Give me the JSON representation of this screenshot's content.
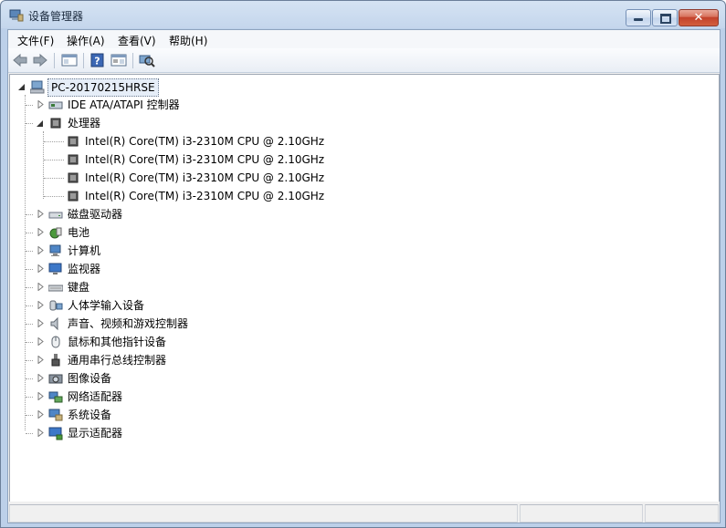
{
  "window": {
    "title": "设备管理器"
  },
  "menubar": {
    "items": [
      {
        "label": "文件(F)"
      },
      {
        "label": "操作(A)"
      },
      {
        "label": "查看(V)"
      },
      {
        "label": "帮助(H)"
      }
    ]
  },
  "toolbar": {
    "buttons": [
      {
        "name": "back-arrow-icon"
      },
      {
        "name": "forward-arrow-icon"
      },
      {
        "name": "show-hide-tree-icon"
      },
      {
        "name": "help-icon"
      },
      {
        "name": "properties-icon"
      },
      {
        "name": "scan-hardware-icon"
      }
    ]
  },
  "tree": {
    "root": {
      "label": "PC-20170215HRSE",
      "icon": "computer-icon",
      "expanded": true
    },
    "categories": [
      {
        "label": "IDE ATA/ATAPI 控制器",
        "icon": "ide-controller-icon",
        "expanded": false
      },
      {
        "label": "处理器",
        "icon": "processor-icon",
        "expanded": true,
        "children": [
          {
            "label": "Intel(R) Core(TM) i3-2310M CPU @ 2.10GHz"
          },
          {
            "label": "Intel(R) Core(TM) i3-2310M CPU @ 2.10GHz"
          },
          {
            "label": "Intel(R) Core(TM) i3-2310M CPU @ 2.10GHz"
          },
          {
            "label": "Intel(R) Core(TM) i3-2310M CPU @ 2.10GHz"
          }
        ]
      },
      {
        "label": "磁盘驱动器",
        "icon": "disk-drive-icon",
        "expanded": false
      },
      {
        "label": "电池",
        "icon": "battery-icon",
        "expanded": false
      },
      {
        "label": "计算机",
        "icon": "computer-category-icon",
        "expanded": false
      },
      {
        "label": "监视器",
        "icon": "monitor-icon",
        "expanded": false
      },
      {
        "label": "键盘",
        "icon": "keyboard-icon",
        "expanded": false
      },
      {
        "label": "人体学输入设备",
        "icon": "hid-icon",
        "expanded": false
      },
      {
        "label": "声音、视频和游戏控制器",
        "icon": "sound-icon",
        "expanded": false
      },
      {
        "label": "鼠标和其他指针设备",
        "icon": "mouse-icon",
        "expanded": false
      },
      {
        "label": "通用串行总线控制器",
        "icon": "usb-icon",
        "expanded": false
      },
      {
        "label": "图像设备",
        "icon": "imaging-device-icon",
        "expanded": false
      },
      {
        "label": "网络适配器",
        "icon": "network-adapter-icon",
        "expanded": false
      },
      {
        "label": "系统设备",
        "icon": "system-device-icon",
        "expanded": false
      },
      {
        "label": "显示适配器",
        "icon": "display-adapter-icon",
        "expanded": false
      }
    ]
  },
  "colors": {
    "root_highlight": "#e6eef8",
    "close_button": "#c2402a"
  }
}
